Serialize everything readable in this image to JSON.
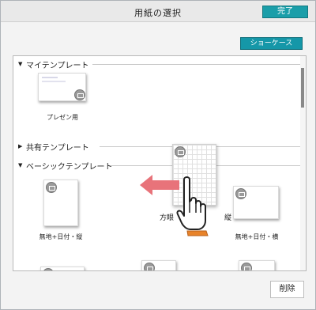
{
  "window": {
    "title": "用紙の選択",
    "done_label": "完了",
    "accent": "#1a9ea9"
  },
  "toolbar": {
    "showcase_label": "ショーケース"
  },
  "sections": {
    "my_templates": {
      "label": "マイテンプレート",
      "expanded": true
    },
    "shared_templates": {
      "label": "共有テンプレート",
      "expanded": false
    },
    "basic_templates": {
      "label": "ベーシックテンプレート",
      "expanded": true
    }
  },
  "templates": {
    "presentation": {
      "label": "プレゼン用"
    },
    "plain_portrait": {
      "label": "無地+日付・縦"
    },
    "grid_portrait": {
      "label": "方眼",
      "label_end": "縦"
    },
    "plain_landscape": {
      "label": "無地+日付・横"
    }
  },
  "footer": {
    "delete_label": "削除"
  },
  "hints": {
    "drag_arrow": "left-arrow-icon",
    "hand": "hand-pointer-icon"
  }
}
